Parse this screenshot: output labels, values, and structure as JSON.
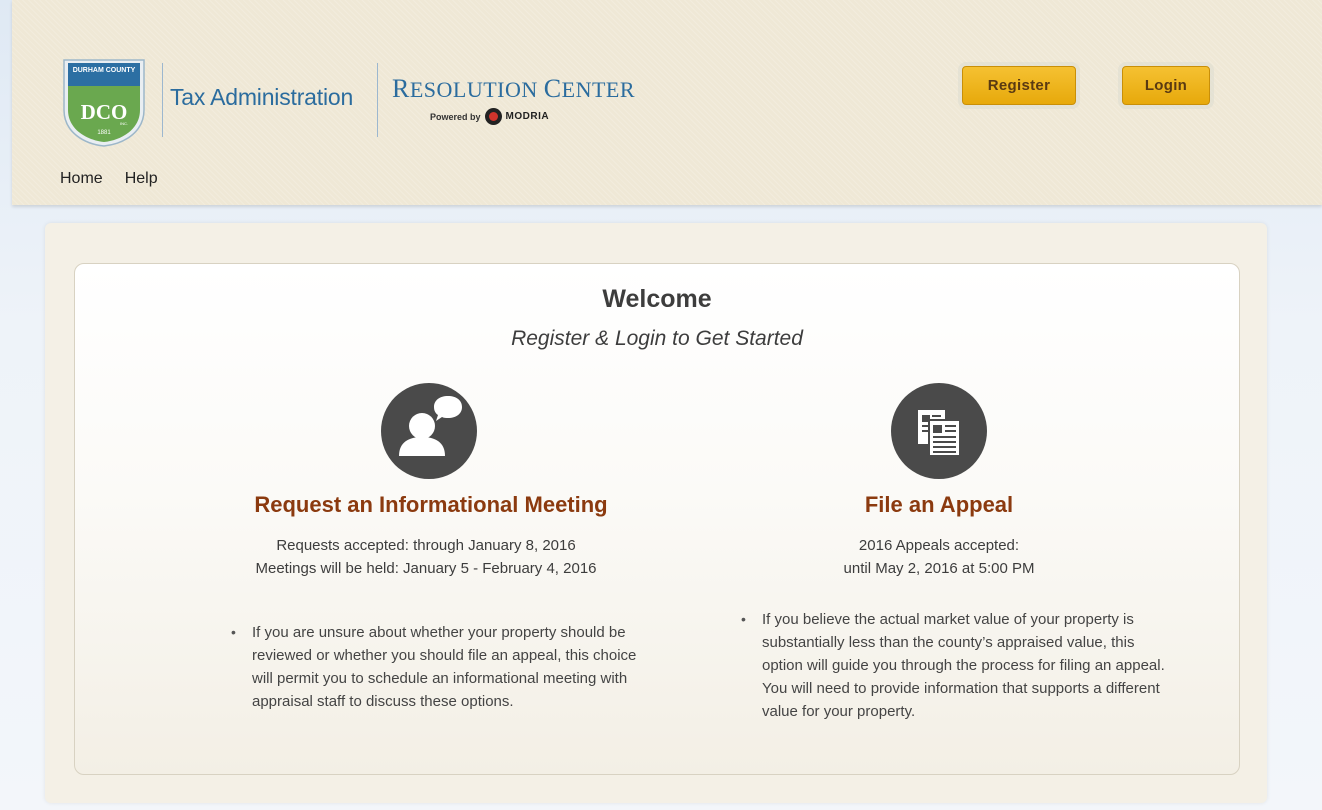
{
  "header": {
    "logo": {
      "top_text": "DURHAM COUNTY",
      "initials": "DCO",
      "year": "1881",
      "inc": "INC."
    },
    "tax_admin": "Tax Administration",
    "resolution_center": {
      "r": "R",
      "esolution": "ESOLUTION",
      "c": "C",
      "enter": "ENTER"
    },
    "powered_by": "Powered by",
    "modria": "MODRIA",
    "register_label": "Register",
    "login_label": "Login"
  },
  "nav": [
    {
      "label": "Home"
    },
    {
      "label": "Help"
    }
  ],
  "main": {
    "welcome": "Welcome",
    "subtitle": "Register & Login to Get Started",
    "options": [
      {
        "icon": "person-speech-icon",
        "title": "Request an Informational Meeting",
        "details": [
          "Requests accepted: through January 8, 2016",
          "Meetings will be held: January 5 - February 4, 2016"
        ],
        "bullet": "If you are unsure about whether your property should be reviewed or whether you should file an appeal, this choice will permit you to schedule an informational meeting with appraisal staff to discuss these options."
      },
      {
        "icon": "documents-icon",
        "title": "File an Appeal",
        "details": [
          "2016 Appeals accepted:",
          "until May 2, 2016 at 5:00 PM"
        ],
        "bullet": "If you believe the actual market value of your property is substantially less than the county’s appraised value, this option will guide you through the process for filing an appeal. You will need to provide information that supports a different value for your property."
      }
    ]
  },
  "colors": {
    "header_bg": "#efe8d6",
    "button_gold": "#f0b31e",
    "title_brown": "#8b3a0f",
    "brand_blue": "#2b6c9e",
    "logo_green": "#6aa84f"
  }
}
